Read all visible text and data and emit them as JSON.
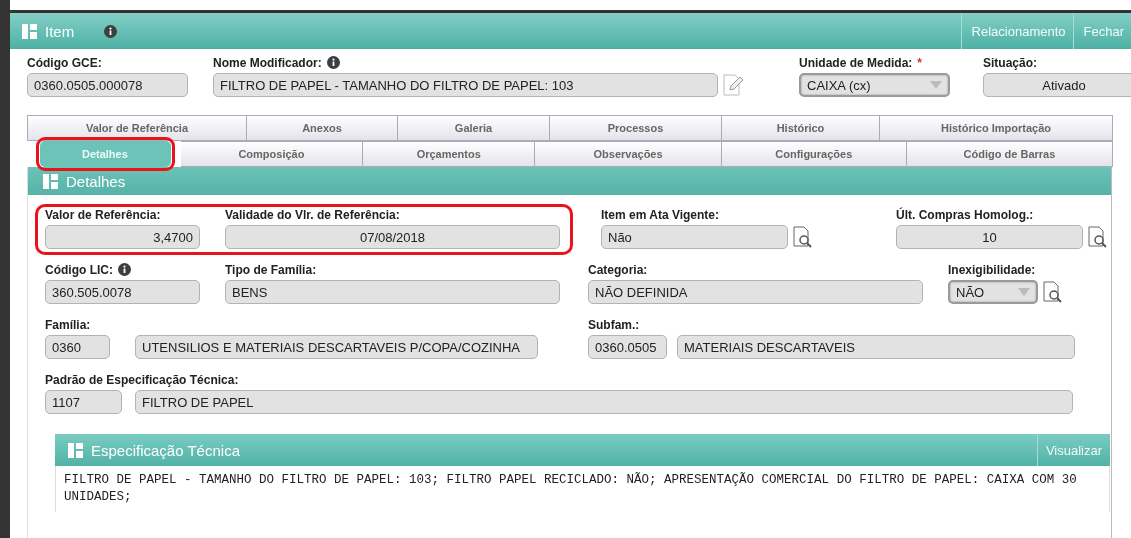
{
  "header": {
    "title": "Item",
    "info": true,
    "actions": [
      "Relacionamento",
      "Fechar"
    ]
  },
  "top_fields": [
    {
      "label": "Código GCE:",
      "values": [
        "0360.0505.000078"
      ],
      "kind": "text"
    },
    {
      "label": "Nome Modificador:",
      "info": true,
      "values": [
        "FILTRO DE PAPEL - TAMANHO DO FILTRO DE PAPEL: 103"
      ],
      "kind": "text",
      "edit": true
    },
    {
      "label": "Unidade de Medida:",
      "required_mark": "*",
      "values": [
        "CAIXA (cx)"
      ],
      "kind": "select"
    },
    {
      "label": "Situação:",
      "values": [
        "Ativado"
      ],
      "kind": "text"
    }
  ],
  "tabs": [
    [
      {
        "label": "Valor de Referência",
        "selected": false
      },
      {
        "label": "Anexos",
        "selected": false
      },
      {
        "label": "Galeria",
        "selected": false
      },
      {
        "label": "Processos",
        "selected": false
      },
      {
        "label": "Histórico",
        "selected": false
      },
      {
        "label": "Histórico Importação",
        "selected": false
      }
    ],
    [
      {
        "label": "Detalhes",
        "selected": true,
        "highlighted": true
      },
      {
        "label": "Composição",
        "selected": false
      },
      {
        "label": "Orçamentos",
        "selected": false
      },
      {
        "label": "Observações",
        "selected": false
      },
      {
        "label": "Configurações",
        "selected": false
      },
      {
        "label": "Código de Barras",
        "selected": false
      }
    ]
  ],
  "details": {
    "title": "Detalhes",
    "rows": [
      [
        {
          "label": "Valor de Referência:",
          "values": [
            "3,4700"
          ],
          "kind": "text",
          "highlighted": true
        },
        {
          "label": "Validade do Vlr. de Referência:",
          "values": [
            "07/08/2018"
          ],
          "kind": "text",
          "highlighted": true
        },
        {
          "label": "Item em Ata Vigente:",
          "values": [
            "Não"
          ],
          "kind": "text",
          "lookup": true
        },
        {
          "label": "Últ. Compras Homolog.:",
          "values": [
            "10"
          ],
          "kind": "text",
          "lookup": true
        }
      ],
      [
        {
          "label": "Código LIC:",
          "info": true,
          "values": [
            "360.505.0078"
          ],
          "kind": "text"
        },
        {
          "label": "Tipo de Família:",
          "values": [
            "BENS"
          ],
          "kind": "text"
        },
        {
          "label": "Categoria:",
          "values": [
            "NÃO DEFINIDA"
          ],
          "kind": "text"
        },
        {
          "label": "Inexigibilidade:",
          "values": [
            "NÃO"
          ],
          "kind": "select",
          "lookup": true
        }
      ],
      [
        {
          "label": "Família:",
          "values": [
            "0360",
            "UTENSILIOS E MATERIAIS DESCARTAVEIS P/COPA/COZINHA"
          ],
          "kind": "text"
        },
        "",
        {
          "label": "Subfam.:",
          "values": [
            "0360.0505",
            "MATERIAIS DESCARTAVEIS"
          ],
          "kind": "text"
        }
      ],
      [
        {
          "label": "Padrão de Especificação Técnica:",
          "values": [
            "1107",
            "FILTRO DE PAPEL"
          ],
          "kind": "text"
        }
      ]
    ]
  },
  "specification": {
    "title": "Especificação Técnica",
    "action": "Visualizar",
    "text": "FILTRO DE PAPEL -  TAMANHO DO FILTRO DE PAPEL: 103; FILTRO PAPEL RECICLADO: NÃO; APRESENTAÇÃO COMERCIAL DO FILTRO DE PAPEL: CAIXA COM 30 UNIDADES;"
  }
}
